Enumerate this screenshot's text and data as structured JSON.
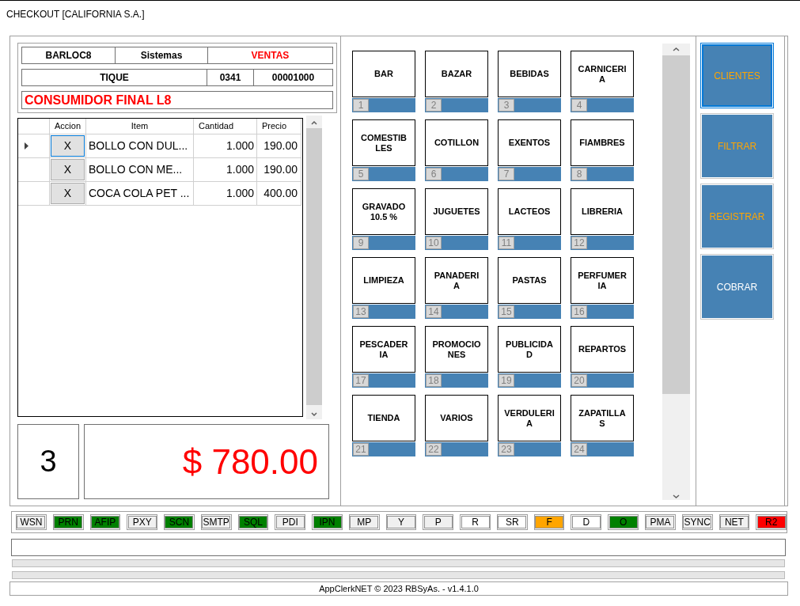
{
  "window": {
    "title": "CHECKOUT [CALIFORNIA S.A.]"
  },
  "header": {
    "terminal": "BARLOC8",
    "area": "Sistemas",
    "mode": "VENTAS",
    "doc_type": "TIQUE",
    "point_of_sale": "0341",
    "doc_number": "00001000",
    "customer": "CONSUMIDOR FINAL L8"
  },
  "grid": {
    "columns": [
      "Accion",
      "Item",
      "Cantidad",
      "Precio"
    ],
    "rows": [
      {
        "action": "X",
        "item": "BOLLO CON DUL...",
        "quantity": "1.000",
        "price": "190.00",
        "selected": true
      },
      {
        "action": "X",
        "item": "BOLLO CON ME...",
        "quantity": "1.000",
        "price": "190.00",
        "selected": false
      },
      {
        "action": "X",
        "item": "COCA COLA PET ...",
        "quantity": "1.000",
        "price": "400.00",
        "selected": false
      }
    ]
  },
  "item_count": "3",
  "total": "$ 780.00",
  "categories": [
    {
      "label": "BAR",
      "number": "1"
    },
    {
      "label": "BAZAR",
      "number": "2"
    },
    {
      "label": "BEBIDAS",
      "number": "3"
    },
    {
      "label": "CARNICERIA",
      "number": "4"
    },
    {
      "label": "COMESTIBLES",
      "number": "5"
    },
    {
      "label": "COTILLON",
      "number": "6"
    },
    {
      "label": "EXENTOS",
      "number": "7"
    },
    {
      "label": "FIAMBRES",
      "number": "8"
    },
    {
      "label": "GRAVADO 10.5 %",
      "number": "9"
    },
    {
      "label": "JUGUETES",
      "number": "10"
    },
    {
      "label": "LACTEOS",
      "number": "11"
    },
    {
      "label": "LIBRERIA",
      "number": "12"
    },
    {
      "label": "LIMPIEZA",
      "number": "13"
    },
    {
      "label": "PANADERIA",
      "number": "14"
    },
    {
      "label": "PASTAS",
      "number": "15"
    },
    {
      "label": "PERFUMERIA",
      "number": "16"
    },
    {
      "label": "PESCADERIA",
      "number": "17"
    },
    {
      "label": "PROMOCIONES",
      "number": "18"
    },
    {
      "label": "PUBLICIDAD",
      "number": "19"
    },
    {
      "label": "REPARTOS",
      "number": "20"
    },
    {
      "label": "TIENDA",
      "number": "21"
    },
    {
      "label": "VARIOS",
      "number": "22"
    },
    {
      "label": "VERDULERIA",
      "number": "23"
    },
    {
      "label": "ZAPATILLAS",
      "number": "24"
    }
  ],
  "actions": [
    {
      "label": "CLIENTES",
      "kind": "option",
      "selected": true
    },
    {
      "label": "FILTRAR",
      "kind": "option",
      "selected": false
    },
    {
      "label": "REGISTRAR",
      "kind": "option",
      "selected": false
    },
    {
      "label": "COBRAR",
      "kind": "payment",
      "selected": false
    }
  ],
  "indicators": [
    {
      "label": "WSN",
      "color": "#f0f0f0"
    },
    {
      "label": "PRN",
      "color": "#008000"
    },
    {
      "label": "AFIP",
      "color": "#008000"
    },
    {
      "label": "PXY",
      "color": "#f0f0f0"
    },
    {
      "label": "SCN",
      "color": "#008000"
    },
    {
      "label": "SMTP",
      "color": "#f0f0f0"
    },
    {
      "label": "SQL",
      "color": "#008000"
    },
    {
      "label": "PDI",
      "color": "#f0f0f0"
    },
    {
      "label": "IPN",
      "color": "#008000"
    },
    {
      "label": "MP",
      "color": "#f0f0f0"
    },
    {
      "label": "Y",
      "color": "#f0f0f0"
    },
    {
      "label": "P",
      "color": "#f0f0f0"
    },
    {
      "label": "R",
      "color": "#ffffff"
    },
    {
      "label": "SR",
      "color": "#ffffff"
    },
    {
      "label": "F",
      "color": "#ffa500"
    },
    {
      "label": "D",
      "color": "#ffffff"
    },
    {
      "label": "O",
      "color": "#008000"
    },
    {
      "label": "PMA",
      "color": "#f0f0f0"
    },
    {
      "label": "SYNC",
      "color": "#f0f0f0"
    },
    {
      "label": "NET",
      "color": "#f0f0f0"
    },
    {
      "label": "R2",
      "color": "#ff0000"
    }
  ],
  "progress_bars": [
    {
      "level": 0
    },
    {
      "level": 0
    }
  ],
  "footer": "AppClerkNET © 2023 RBSyAs. - v1.4.1.0"
}
